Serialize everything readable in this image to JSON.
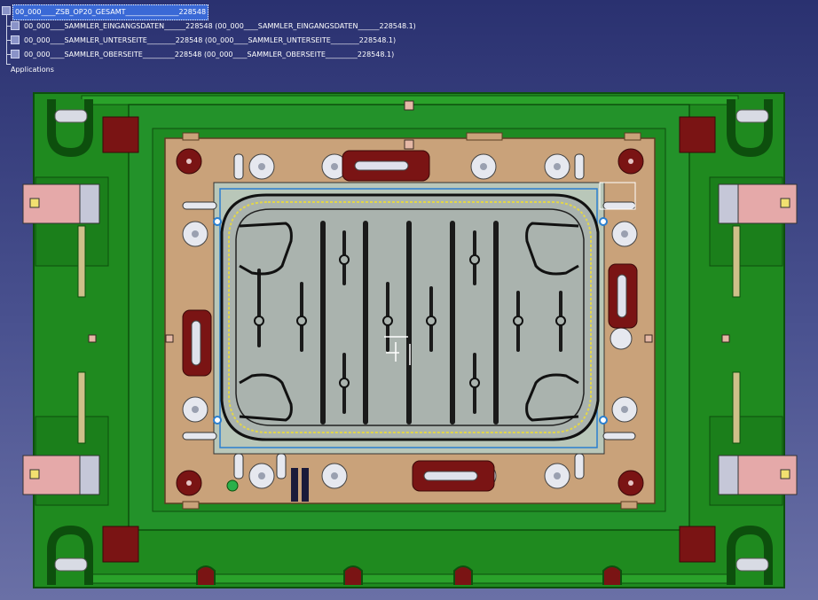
{
  "spec_tree": {
    "root": {
      "label": "00_000____ZSB_OP20_GESAMT_______________228548",
      "selected": true
    },
    "children": [
      {
        "label": "00_000____SAMMLER_EINGANGSDATEN______228548 (00_000____SAMMLER_EINGANGSDATEN______228548.1)"
      },
      {
        "label": "00_000____SAMMLER_UNTERSEITE________228548 (00_000____SAMMLER_UNTERSEITE________228548.1)"
      },
      {
        "label": "00_000____SAMMLER_OBERSEITE_________228548 (00_000____SAMMLER_OBERSEITE_________228548.1)"
      }
    ],
    "applications_label": "Applications"
  },
  "colors": {
    "background_top": "#2a3170",
    "background_bottom": "#6a70a6",
    "die_green": "#1f8a1f",
    "die_green_dark": "#0d4f0d",
    "plate_tan": "#c9a27a",
    "panel_grey": "#aab3ae",
    "dark_red": "#7a1414",
    "pink_block": "#e5a9a9",
    "outline_blue": "#2a7fd0"
  },
  "icons": [
    "tree-root-icon",
    "assembly-icon",
    "part-icon",
    "applications-branch"
  ]
}
